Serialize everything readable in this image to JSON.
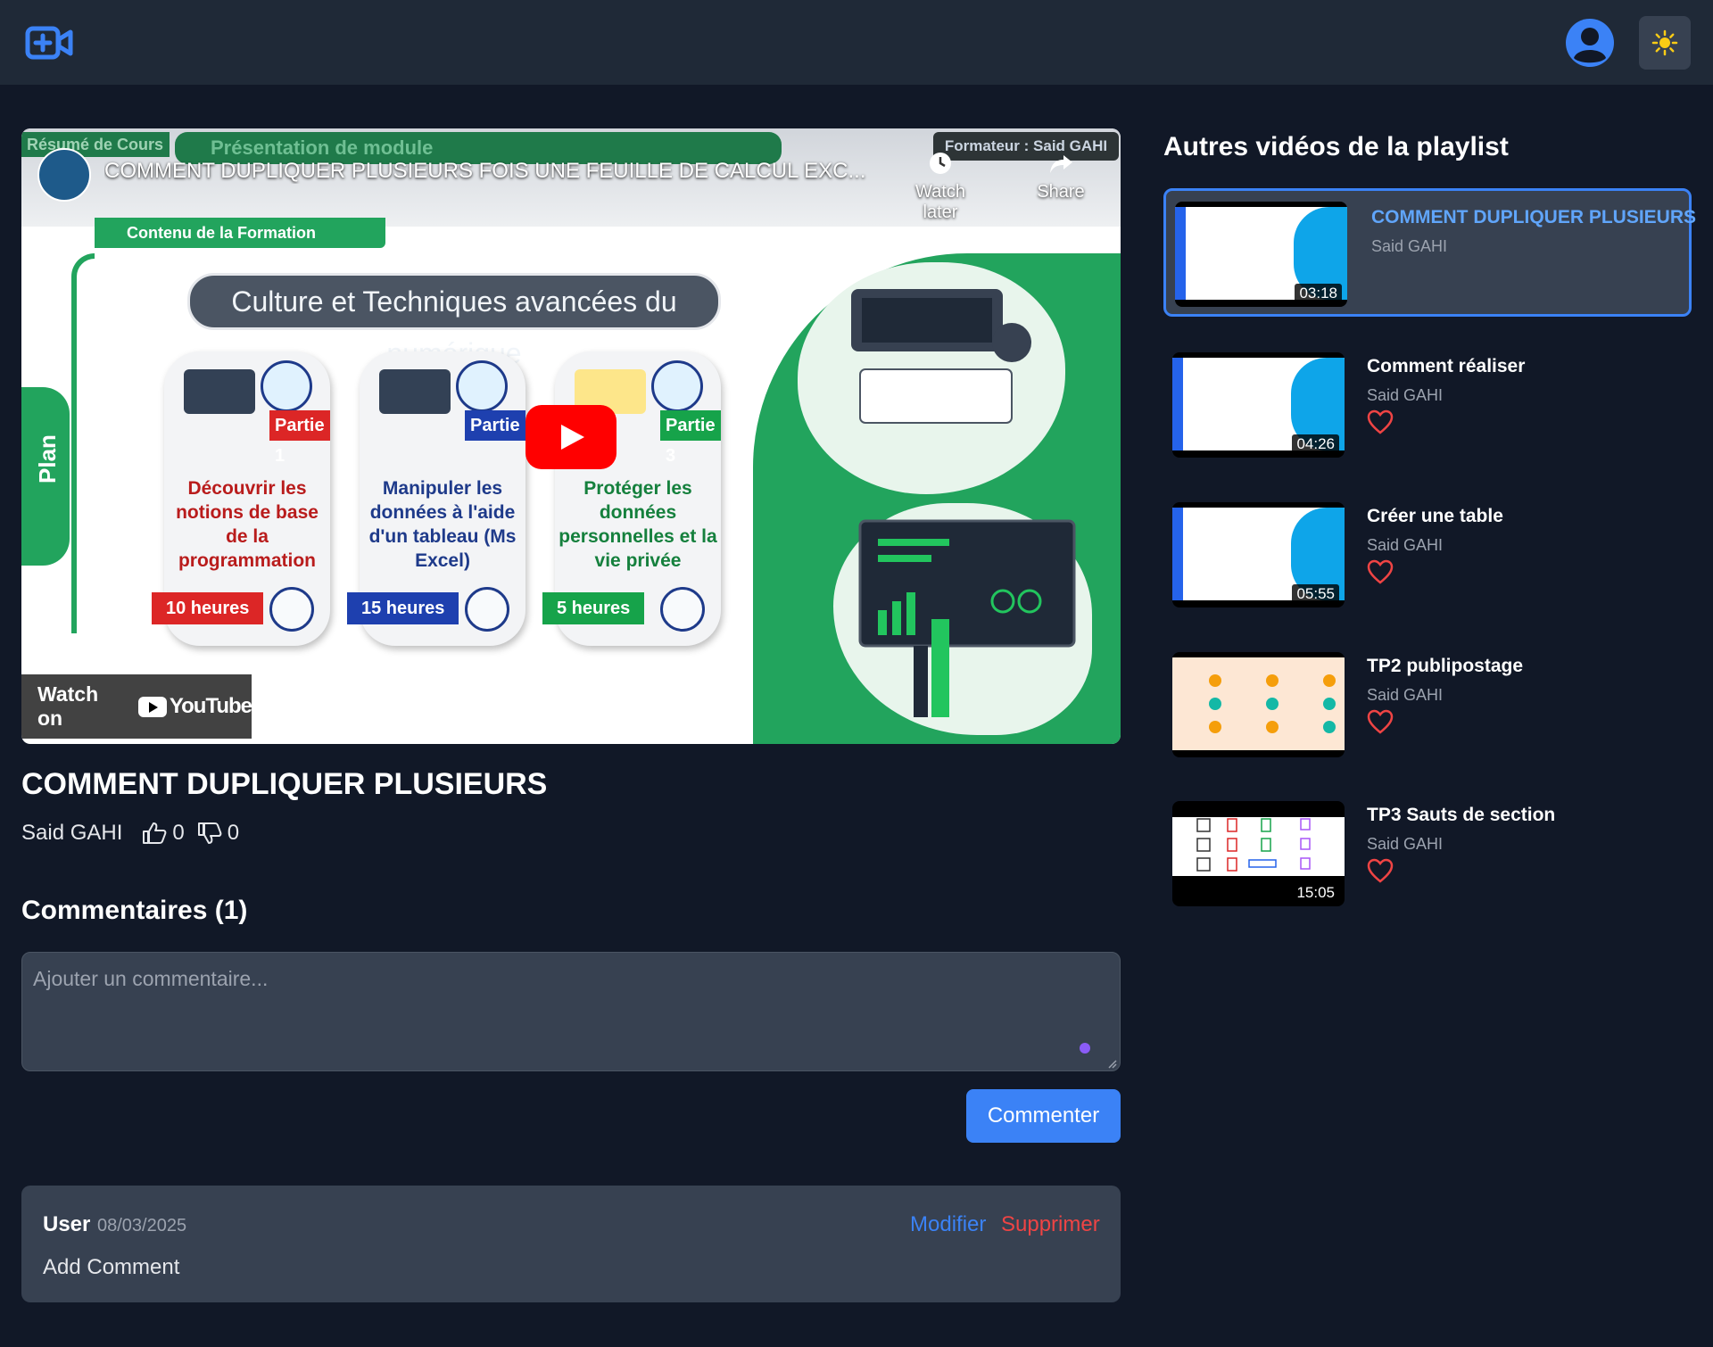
{
  "header": {
    "logo_icon": "video-plus-icon",
    "profile_icon": "user-circle-icon",
    "theme_icon": "sun-icon",
    "accent_color": "#3b82f6"
  },
  "player": {
    "ribbon_left": "Résumé de Cours",
    "ribbon_center": "Présentation de  module",
    "formateur": "Formateur : Said GAHI",
    "yt_title": "COMMENT DUPLIQUER PLUSIEURS FOIS UNE FEUILLE DE CALCUL EXC...",
    "watch_later": "Watch later",
    "share": "Share",
    "contenu": "Contenu de la Formation",
    "plan": "Plan",
    "headline": "Culture et Techniques avancées du numérique",
    "cards": [
      {
        "part": "Partie 1",
        "text": "Découvrir les notions de base de la programmation",
        "hours": "10 heures",
        "color": "#b91c1c",
        "hours_bg": "#dc2626"
      },
      {
        "part": "Partie",
        "text": "Manipuler les données à l'aide d'un tableau (Ms Excel)",
        "hours": "15 heures",
        "color": "#1e3a8a",
        "hours_bg": "#1e40af"
      },
      {
        "part": "Partie 3",
        "text": "Protéger les données personnelles et la vie privée",
        "hours": "5 heures",
        "color": "#15803d",
        "hours_bg": "#16a34a"
      }
    ],
    "watch_on": "Watch on",
    "youtube": "YouTube"
  },
  "video": {
    "title": "COMMENT DUPLIQUER PLUSIEURS",
    "author": "Said GAHI",
    "likes": "0",
    "dislikes": "0"
  },
  "comments": {
    "title": "Commentaires (1)",
    "placeholder": "Ajouter un commentaire...",
    "submit_label": "Commenter",
    "items": [
      {
        "user": "User",
        "date": "08/03/2025",
        "edit": "Modifier",
        "delete": "Supprimer",
        "text": "Add Comment"
      }
    ]
  },
  "playlist": {
    "title": "Autres vidéos de la playlist",
    "items": [
      {
        "title": "COMMENT DUPLIQUER PLUSIEURS",
        "author": "Said GAHI",
        "duration": "03:18",
        "active": true
      },
      {
        "title": "Comment réaliser",
        "author": "Said GAHI",
        "duration": "04:26",
        "active": false
      },
      {
        "title": "Créer une table",
        "author": "Said GAHI",
        "duration": "05:55",
        "active": false
      },
      {
        "title": "TP2 publipostage",
        "author": "Said GAHI",
        "duration": "",
        "active": false
      },
      {
        "title": "TP3 Sauts de section",
        "author": "Said GAHI",
        "duration": "15:05",
        "active": false
      }
    ]
  }
}
